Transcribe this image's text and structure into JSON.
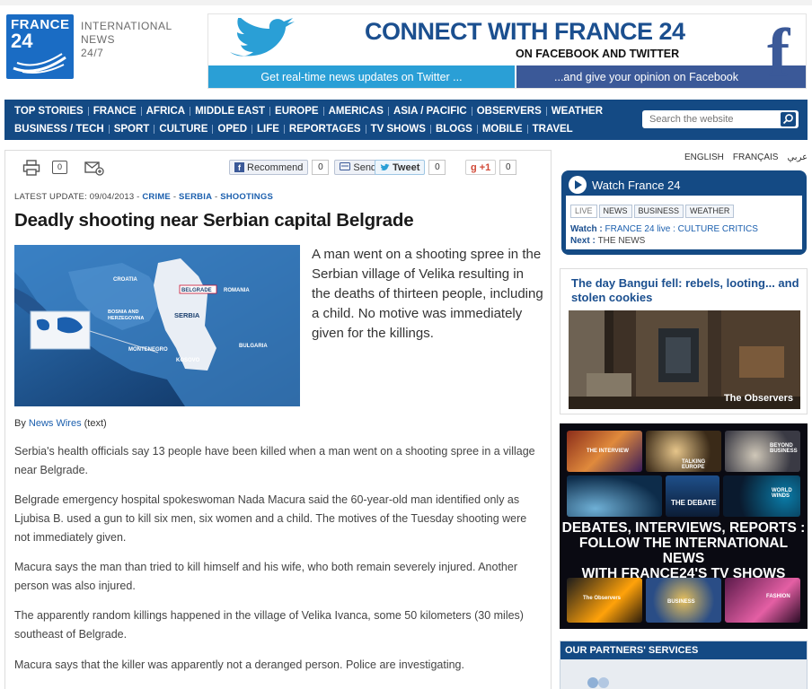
{
  "logo": {
    "line1": "FRANCE",
    "line2": "24"
  },
  "tagline": {
    "l1": "INTERNATIONAL",
    "l2": "NEWS",
    "l3": "24/7"
  },
  "banner": {
    "title": "CONNECT WITH FRANCE 24",
    "subtitle": "ON FACEBOOK AND TWITTER",
    "left_text": "Get real-time news updates on Twitter ...",
    "right_text": "...and give your opinion on Facebook",
    "fb_letter": "f"
  },
  "nav": {
    "row1": [
      "TOP STORIES",
      "FRANCE",
      "AFRICA",
      "MIDDLE EAST",
      "EUROPE",
      "AMERICAS",
      "ASIA / PACIFIC",
      "OBSERVERS",
      "WEATHER"
    ],
    "row2": [
      "BUSINESS / TECH",
      "SPORT",
      "CULTURE",
      "OPED",
      "LIFE",
      "REPORTAGES",
      "TV SHOWS",
      "BLOGS",
      "MOBILE",
      "TRAVEL"
    ],
    "search_placeholder": "Search the website"
  },
  "tools": {
    "comment_count": "0",
    "recommend_label": "Recommend",
    "recommend_count": "0",
    "send_label": "Send",
    "tweet_label": "Tweet",
    "tweet_count": "0",
    "gplus_label": "+1",
    "gplus_count": "0"
  },
  "article": {
    "update_prefix": "LATEST UPDATE: 09/04/2013 - ",
    "cat1": "CRIME",
    "cat2": "SERBIA",
    "cat3": "SHOOTINGS",
    "sep": " - ",
    "headline": "Deadly shooting near Serbian capital Belgrade",
    "lead": "A man went on a shooting spree in the Serbian village of Velika resulting in the deaths of thirteen people, including a child. No motive was immediately given for the killings.",
    "by_prefix": "By ",
    "by_author": "News Wires",
    "by_suffix": " (text)",
    "paragraphs": [
      "Serbia's health officials say 13 people have been killed when a man went on a shooting spree in a village near Belgrade.",
      "Belgrade emergency hospital spokeswoman Nada Macura said the 60-year-old man identified only as Ljubisa B. used a gun to kill six men, six women and a child. The motives of the Tuesday shooting were not immediately given.",
      "Macura says the man than tried to kill himself and his wife, who both remain severely injured. Another person was also injured.",
      "The apparently random killings happened in the village of Velika Ivanca, some 50 kilometers (30 miles) southeast of Belgrade.",
      "Macura says that the killer was apparently not a deranged person. Police are investigating."
    ],
    "map_labels": {
      "croatia": "CROATIA",
      "bosnia1": "BOSNIA AND",
      "bosnia2": "HERZEGOVINA",
      "serbia": "SERBIA",
      "belgrade": "BELGRADE",
      "romania": "ROMANIA",
      "montenegro": "MONTENEGRO",
      "kosovo": "KOSOVO",
      "bulgaria": "BULGARIA"
    }
  },
  "lang": {
    "en": "ENGLISH",
    "fr": "FRANÇAIS",
    "ar": "عربي"
  },
  "watch": {
    "title": "Watch France 24",
    "tabs": [
      "LIVE",
      "NEWS",
      "BUSINESS",
      "WEATHER"
    ],
    "watch_label": "Watch : ",
    "watch_value": "FRANCE 24 live : CULTURE CRITICS",
    "next_label": "Next : ",
    "next_value": "THE NEWS"
  },
  "story": {
    "title": "The day Bangui fell: rebels, looting... and stolen cookies",
    "logo_text": "The Observers"
  },
  "promo": {
    "line1": "DEBATES, INTERVIEWS, REPORTS :",
    "line2": "FOLLOW THE INTERNATIONAL NEWS",
    "line3": "WITH FRANCE24'S TV SHOWS",
    "tiles": {
      "interview": "THE INTERVIEW",
      "talking": "TALKING EUROPE",
      "beyond": "BEYOND BUSINESS",
      "debate": "THE DEBATE",
      "world": "WORLD WINDS",
      "observers": "The Observers",
      "business": "BUSINESS",
      "fashion": "FASHION"
    }
  },
  "partners": {
    "title": "OUR PARTNERS' SERVICES"
  }
}
